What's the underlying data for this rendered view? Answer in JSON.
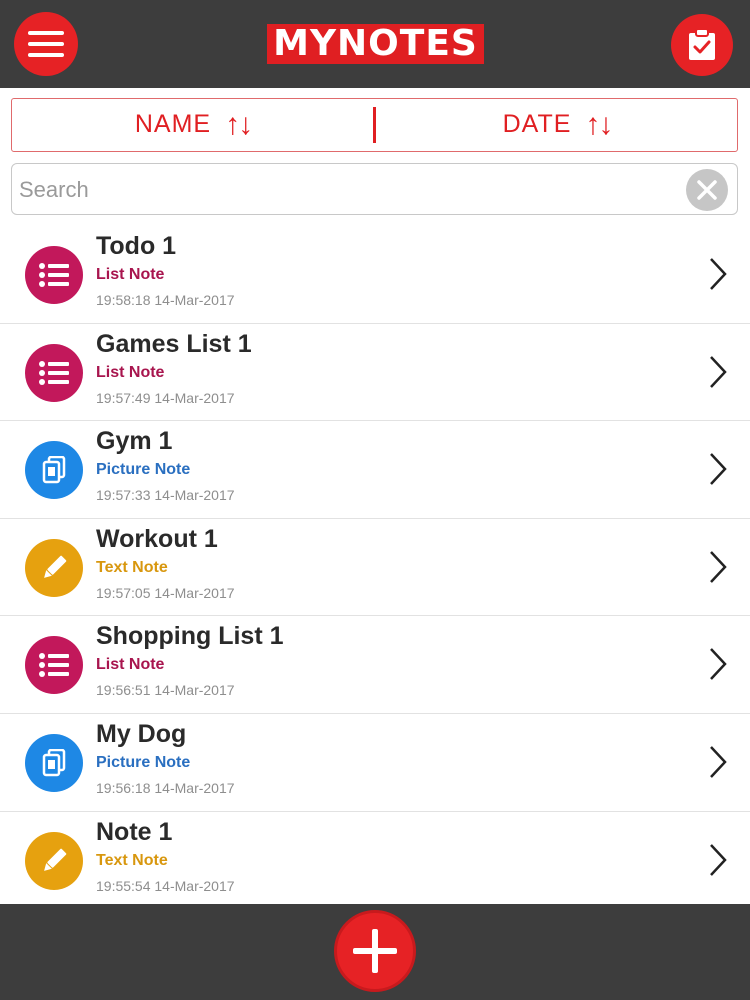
{
  "header": {
    "logo_text": "MYNOTES",
    "menu_icon": "hamburger-menu-icon",
    "clipboard_icon": "clipboard-check-icon"
  },
  "sort": {
    "name_label": "NAME",
    "date_label": "DATE",
    "arrows": "↑↓"
  },
  "search": {
    "placeholder": "Search",
    "value": ""
  },
  "notes": [
    {
      "title": "Todo 1",
      "type": "List Note",
      "timestamp": "19:58:18 14-Mar-2017",
      "kind": "list"
    },
    {
      "title": "Games List 1",
      "type": "List Note",
      "timestamp": "19:57:49 14-Mar-2017",
      "kind": "list"
    },
    {
      "title": "Gym 1",
      "type": "Picture Note",
      "timestamp": "19:57:33 14-Mar-2017",
      "kind": "picture"
    },
    {
      "title": "Workout 1",
      "type": "Text Note",
      "timestamp": "19:57:05 14-Mar-2017",
      "kind": "text"
    },
    {
      "title": "Shopping List 1",
      "type": "List Note",
      "timestamp": "19:56:51 14-Mar-2017",
      "kind": "list"
    },
    {
      "title": "My Dog",
      "type": "Picture Note",
      "timestamp": "19:56:18 14-Mar-2017",
      "kind": "picture"
    },
    {
      "title": "Note 1",
      "type": "Text Note",
      "timestamp": "19:55:54 14-Mar-2017",
      "kind": "text"
    }
  ],
  "colors": {
    "brand_red": "#e62225",
    "bar_dark": "#3d3d3d",
    "list_note": "#c2185b",
    "picture_note": "#1e88e5",
    "text_note": "#e6a10f",
    "list_note_text": "#a8154e",
    "picture_note_text": "#2a6fc0",
    "text_note_text": "#d8970e"
  }
}
